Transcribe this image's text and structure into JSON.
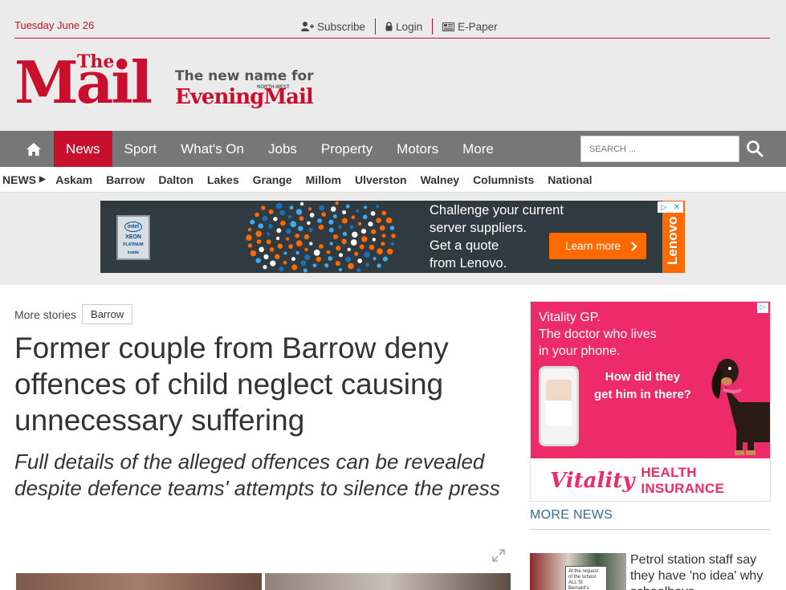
{
  "header": {
    "date": "Tuesday June 26",
    "links": [
      {
        "label": "Subscribe",
        "icon": "add-user-icon"
      },
      {
        "label": "Login",
        "icon": "lock-icon"
      },
      {
        "label": "E-Paper",
        "icon": "newspaper-icon"
      }
    ],
    "logo": {
      "the": "The",
      "mail": "Mail",
      "tagline": "The new name for",
      "north_west": "NORTH-WEST",
      "evening_mail": "EveningMail"
    }
  },
  "main_nav": {
    "items": [
      "News",
      "Sport",
      "What's On",
      "Jobs",
      "Property",
      "Motors",
      "More"
    ],
    "active": "News",
    "search_placeholder": "SEARCH ..."
  },
  "sub_nav": {
    "label": "NEWS",
    "items": [
      "Askam",
      "Barrow",
      "Dalton",
      "Lakes",
      "Grange",
      "Millom",
      "Ulverston",
      "Walney",
      "Columnists",
      "National"
    ]
  },
  "banner_ad": {
    "chip_text": [
      "intel",
      "XEON",
      "PLATINUM",
      "inside"
    ],
    "lines": [
      "Challenge your current",
      "server suppliers.",
      "Get a quote",
      "from Lenovo."
    ],
    "cta": "Learn more",
    "brand": "Lenovo",
    "accent": "#ff6a00"
  },
  "article": {
    "more_stories": "More stories",
    "tag": "Barrow",
    "headline": "Former couple from Barrow deny offences of child neglect causing unnecessary suffering",
    "standfirst": "Full details of the alleged offences can be revealed despite defence teams' attempts to silence the press"
  },
  "side_ad": {
    "lines": [
      "Vitality GP.",
      "The doctor who lives",
      "in your phone."
    ],
    "question": [
      "How did they",
      "get him in there?"
    ],
    "brand": "Vitality",
    "product": "HEALTH INSURANCE",
    "accent": "#ed2b6a"
  },
  "more_news": {
    "heading": "MORE NEWS",
    "items": [
      {
        "title": "Petrol station staff say they have 'no idea' why schoolboys",
        "thumb_note": "At the request of the school ALL St Bernard's"
      }
    ]
  },
  "colors": {
    "brand_red": "#c8102e",
    "nav_grey": "#777777",
    "masthead_bg": "#ebebeb",
    "link_blue": "#2e6f94"
  }
}
